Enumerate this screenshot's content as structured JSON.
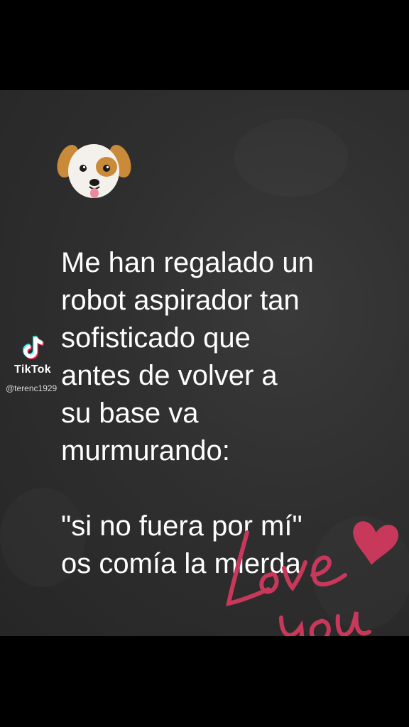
{
  "video": {
    "message_lines": [
      "Me han regalado un",
      "robot aspirador tan",
      "sofisticado que",
      "antes de volver a",
      "su base va",
      "murmurando:"
    ],
    "quote_lines": [
      "\"si no fuera por mí\"",
      "os comía la mierda"
    ],
    "emoji": "dog-face-icon",
    "sticker": "love-you-heart-sticker"
  },
  "watermark": {
    "brand": "TikTok",
    "handle": "@terenc1929"
  },
  "colors": {
    "background": "#2f2f2f",
    "letterbox": "#000000",
    "text": "#ffffff",
    "accent": "#c8385a"
  }
}
